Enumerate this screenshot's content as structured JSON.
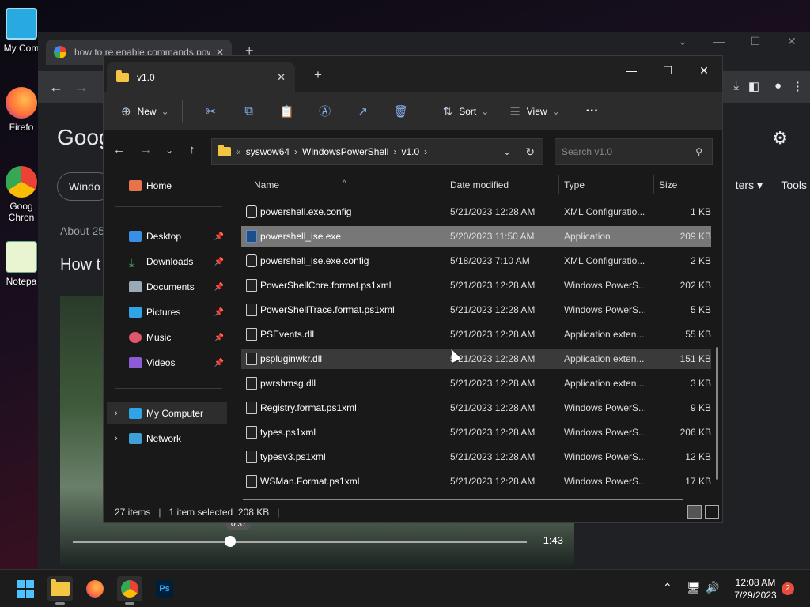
{
  "desktop": {
    "icons": [
      {
        "label": "My Com",
        "name": "my-computer"
      },
      {
        "label": "Firefo",
        "name": "firefox"
      },
      {
        "label": "Goog Chron",
        "name": "google-chrome"
      },
      {
        "label": "Notepa",
        "name": "notepad"
      }
    ]
  },
  "chrome": {
    "tab_title": "how to re enable commands pow",
    "logo_text": "Goog",
    "chip_label": "Windo",
    "filters_label": "ters",
    "tools_label": "Tools",
    "about_text": "About 25",
    "heading": "How t",
    "video_time_bubble": "0:37",
    "video_duration": "1:43",
    "video_progress_fraction": 0.35
  },
  "explorer": {
    "tab_title": "v1.0",
    "commands": {
      "new": "New",
      "sort": "Sort",
      "view": "View",
      "more": "···"
    },
    "breadcrumb": [
      "syswow64",
      "WindowsPowerShell",
      "v1.0"
    ],
    "breadcrumb_prefix": "«",
    "search_placeholder": "Search v1.0",
    "nav": {
      "home": "Home",
      "desktop": "Desktop",
      "downloads": "Downloads",
      "documents": "Documents",
      "pictures": "Pictures",
      "music": "Music",
      "videos": "Videos",
      "my_computer": "My Computer",
      "network": "Network"
    },
    "columns": {
      "name": "Name",
      "date": "Date modified",
      "type": "Type",
      "size": "Size"
    },
    "files": [
      {
        "name": "powershell.exe.config",
        "date": "5/21/2023 12:28 AM",
        "type": "XML Configuratio...",
        "size": "1 KB",
        "icon": "config",
        "state": ""
      },
      {
        "name": "powershell_ise.exe",
        "date": "5/20/2023 11:50 AM",
        "type": "Application",
        "size": "209 KB",
        "icon": "powershell",
        "state": "selected"
      },
      {
        "name": "powershell_ise.exe.config",
        "date": "5/18/2023 7:10 AM",
        "type": "XML Configuratio...",
        "size": "2 KB",
        "icon": "config",
        "state": ""
      },
      {
        "name": "PowerShellCore.format.ps1xml",
        "date": "5/21/2023 12:28 AM",
        "type": "Windows PowerS...",
        "size": "202 KB",
        "icon": "file",
        "state": ""
      },
      {
        "name": "PowerShellTrace.format.ps1xml",
        "date": "5/21/2023 12:28 AM",
        "type": "Windows PowerS...",
        "size": "5 KB",
        "icon": "file",
        "state": ""
      },
      {
        "name": "PSEvents.dll",
        "date": "5/21/2023 12:28 AM",
        "type": "Application exten...",
        "size": "55 KB",
        "icon": "file",
        "state": ""
      },
      {
        "name": "pspluginwkr.dll",
        "date": "5/21/2023 12:28 AM",
        "type": "Application exten...",
        "size": "151 KB",
        "icon": "file",
        "state": "hover"
      },
      {
        "name": "pwrshmsg.dll",
        "date": "5/21/2023 12:28 AM",
        "type": "Application exten...",
        "size": "3 KB",
        "icon": "file",
        "state": ""
      },
      {
        "name": "Registry.format.ps1xml",
        "date": "5/21/2023 12:28 AM",
        "type": "Windows PowerS...",
        "size": "9 KB",
        "icon": "file",
        "state": ""
      },
      {
        "name": "types.ps1xml",
        "date": "5/21/2023 12:28 AM",
        "type": "Windows PowerS...",
        "size": "206 KB",
        "icon": "file",
        "state": ""
      },
      {
        "name": "typesv3.ps1xml",
        "date": "5/21/2023 12:28 AM",
        "type": "Windows PowerS...",
        "size": "12 KB",
        "icon": "file",
        "state": ""
      },
      {
        "name": "WSMan.Format.ps1xml",
        "date": "5/21/2023 12:28 AM",
        "type": "Windows PowerS...",
        "size": "17 KB",
        "icon": "file",
        "state": ""
      }
    ],
    "status": {
      "items": "27 items",
      "selected": "1 item selected  208 KB"
    }
  },
  "taskbar": {
    "clock_time": "12:08 AM",
    "clock_date": "7/29/2023",
    "notification_count": "2"
  }
}
